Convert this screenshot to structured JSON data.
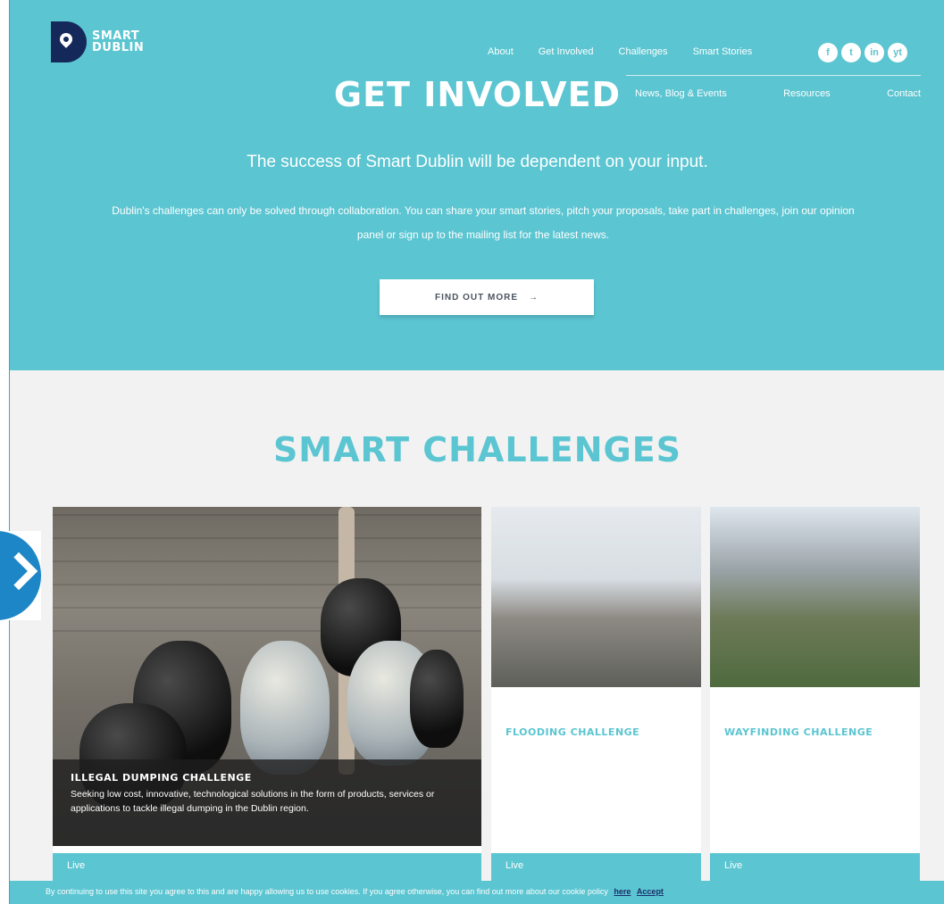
{
  "brand": {
    "line1": "SMART",
    "line2": "DUBLIN"
  },
  "nav": {
    "top": [
      "About",
      "Get Involved",
      "Challenges",
      "Smart Stories"
    ],
    "bottom": [
      "News, Blog & Events",
      "Resources",
      "Contact"
    ],
    "social": [
      "f",
      "t",
      "in",
      "yt"
    ]
  },
  "hero": {
    "title": "GET INVOLVED",
    "tagline": "The success of Smart Dublin will be dependent on your input.",
    "body": "Dublin's challenges can only be solved through collaboration. You can share your smart stories, pitch your proposals, take part in challenges, join our opinion panel or sign up to the mailing list for the latest news.",
    "cta": "FIND OUT MORE",
    "cta_arrow": "→"
  },
  "challenges": {
    "title": "SMART CHALLENGES",
    "featured": {
      "title": "ILLEGAL DUMPING CHALLENGE",
      "desc": "Seeking low cost, innovative, technological solutions in the form of products, services or applications to tackle illegal dumping in the Dublin region.",
      "status": "Live"
    },
    "items": [
      {
        "title": "FLOODING CHALLENGE",
        "status": "Live"
      },
      {
        "title": "WAYFINDING CHALLENGE",
        "status": "Live"
      }
    ]
  },
  "cookie": {
    "text": "By continuing to use this site you agree to this and are happy allowing us to use cookies. If you agree otherwise, you can find out more about our cookie policy",
    "here": "here",
    "accept": "Accept"
  },
  "colors": {
    "accent": "#5bc5d1",
    "brand_dark": "#14285a",
    "arrow": "#1d86c6"
  }
}
